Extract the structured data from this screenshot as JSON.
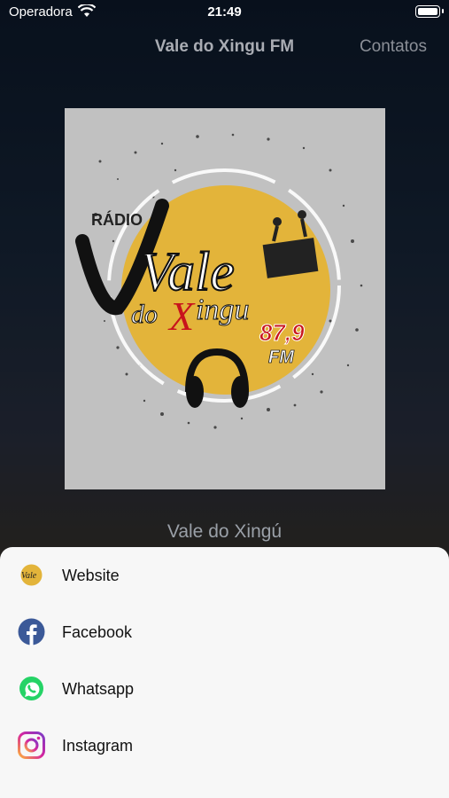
{
  "status": {
    "carrier": "Operadora",
    "time": "21:49"
  },
  "nav": {
    "title": "Vale do Xingu FM",
    "contacts": "Contatos"
  },
  "artwork": {
    "radio": "RÁDIO",
    "vale": "Vale",
    "do": "do",
    "x": "X",
    "ingu": "ingu",
    "freq": "87,9",
    "fm": "FM"
  },
  "station_name": "Vale do Xingú",
  "sheet": {
    "items": [
      {
        "label": "Website",
        "icon": "website-logo-icon"
      },
      {
        "label": "Facebook",
        "icon": "facebook-icon"
      },
      {
        "label": "Whatsapp",
        "icon": "whatsapp-icon"
      },
      {
        "label": "Instagram",
        "icon": "instagram-icon"
      }
    ]
  },
  "colors": {
    "facebook": "#3b5998",
    "whatsapp": "#25d366",
    "instagram": "#d6249f",
    "logo_yellow": "#e3b43a"
  }
}
